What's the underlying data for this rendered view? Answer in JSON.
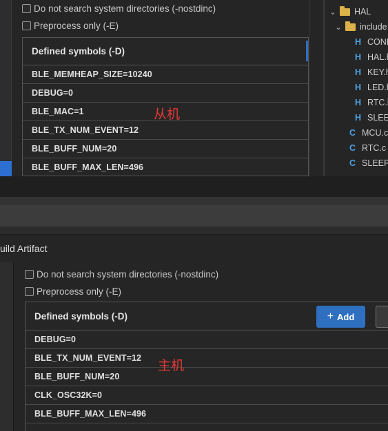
{
  "top_panel": {
    "checkboxes": [
      {
        "label": "Do not search system directories (-nostdinc)",
        "checked": false
      },
      {
        "label": "Preprocess only (-E)",
        "checked": false
      }
    ],
    "symbols_header": "Defined symbols (-D)",
    "symbols": [
      "BLE_MEMHEAP_SIZE=10240",
      "DEBUG=0",
      "BLE_MAC=1",
      "BLE_TX_NUM_EVENT=12",
      "BLE_BUFF_NUM=20",
      "BLE_BUFF_MAX_LEN=496"
    ],
    "annotation": "从机",
    "annotation_color": "#e53935"
  },
  "explorer": {
    "items": [
      {
        "type": "folder",
        "label": "HAL",
        "expanded": true
      },
      {
        "type": "folder",
        "label": "include",
        "expanded": true
      },
      {
        "type": "h",
        "label": "CONF"
      },
      {
        "type": "h",
        "label": "HAL.h"
      },
      {
        "type": "h",
        "label": "KEY.h"
      },
      {
        "type": "h",
        "label": "LED.h"
      },
      {
        "type": "h",
        "label": "RTC.h"
      },
      {
        "type": "h",
        "label": "SLEEP"
      },
      {
        "type": "c",
        "label": "MCU.c"
      },
      {
        "type": "c",
        "label": "RTC.c"
      },
      {
        "type": "c",
        "label": "SLEEP.c"
      }
    ]
  },
  "title_bar": {
    "title": "uild Artifact"
  },
  "bottom_panel": {
    "checkboxes": [
      {
        "label": "Do not search system directories (-nostdinc)",
        "checked": false
      },
      {
        "label": "Preprocess only (-E)",
        "checked": false
      }
    ],
    "symbols_header": "Defined symbols (-D)",
    "add_button": "Add",
    "symbols": [
      "DEBUG=0",
      "BLE_TX_NUM_EVENT=12",
      "BLE_BUFF_NUM=20",
      "CLK_OSC32K=0",
      "BLE_BUFF_MAX_LEN=496"
    ],
    "annotation": "主机",
    "annotation_color": "#e53935",
    "accent_color": "#2e6fc0"
  }
}
